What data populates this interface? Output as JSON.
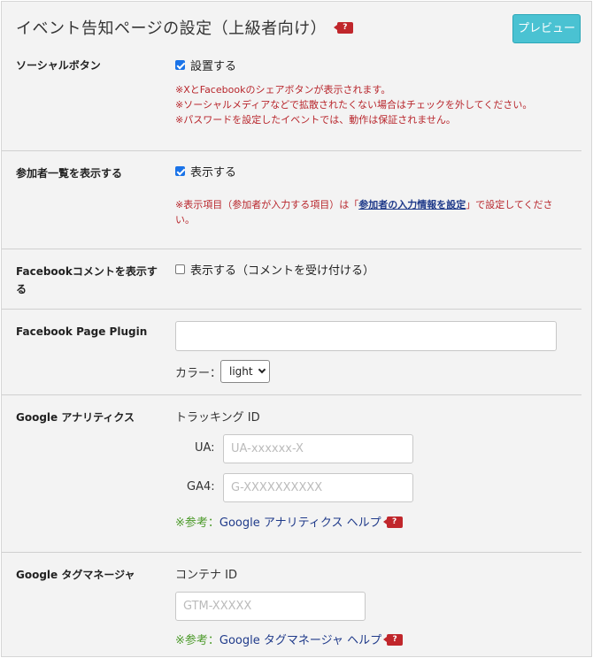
{
  "header": {
    "title": "イベント告知ページの設定（上級者向け）",
    "help_badge": "?",
    "preview_label": "プレビュー"
  },
  "social": {
    "label": "ソーシャルボタン",
    "checkbox_label": "設置する",
    "checked": true,
    "notes": [
      "※XとFacebookのシェアボタンが表示されます。",
      "※ソーシャルメディアなどで拡散されたくない場合はチェックを外してください。",
      "※パスワードを設定したイベントでは、動作は保証されません。"
    ]
  },
  "participants": {
    "label": "参加者一覧を表示する",
    "checkbox_label": "表示する",
    "checked": true,
    "note_prefix": "※表示項目（参加者が入力する項目）は「",
    "note_link": "参加者の入力情報を設定",
    "note_mid": "」で設定してくださ",
    "note_tail": "い。"
  },
  "fb_comment": {
    "label_line1": "Facebookコメントを表示す",
    "label_line2": "る",
    "checkbox_label": "表示する（コメントを受け付ける）",
    "checked": false
  },
  "fb_page_plugin": {
    "label": "Facebook Page Plugin",
    "input_value": "",
    "color_label": "カラー：",
    "color_value": "light"
  },
  "ga": {
    "label": "Google アナリティクス",
    "tracking_heading": "トラッキング ID",
    "ua_label": "UA:",
    "ua_placeholder": "UA-xxxxxx-X",
    "ga4_label": "GA4:",
    "ga4_placeholder": "G-XXXXXXXXXX",
    "ref_prefix": "※参考：",
    "ref_link": "Google アナリティクス ヘルプ"
  },
  "gtm": {
    "label": "Google タグマネージャ",
    "container_heading": "コンテナ ID",
    "placeholder": "GTM-XXXXX",
    "ref_prefix": "※参考：",
    "ref_link": "Google タグマネージャ ヘルプ"
  },
  "colors": {
    "accent": "#4ac2d2",
    "warning": "#b8262c",
    "link": "#1f3a8a",
    "ref_green": "#4c9a2a",
    "badge": "#c0262b"
  }
}
